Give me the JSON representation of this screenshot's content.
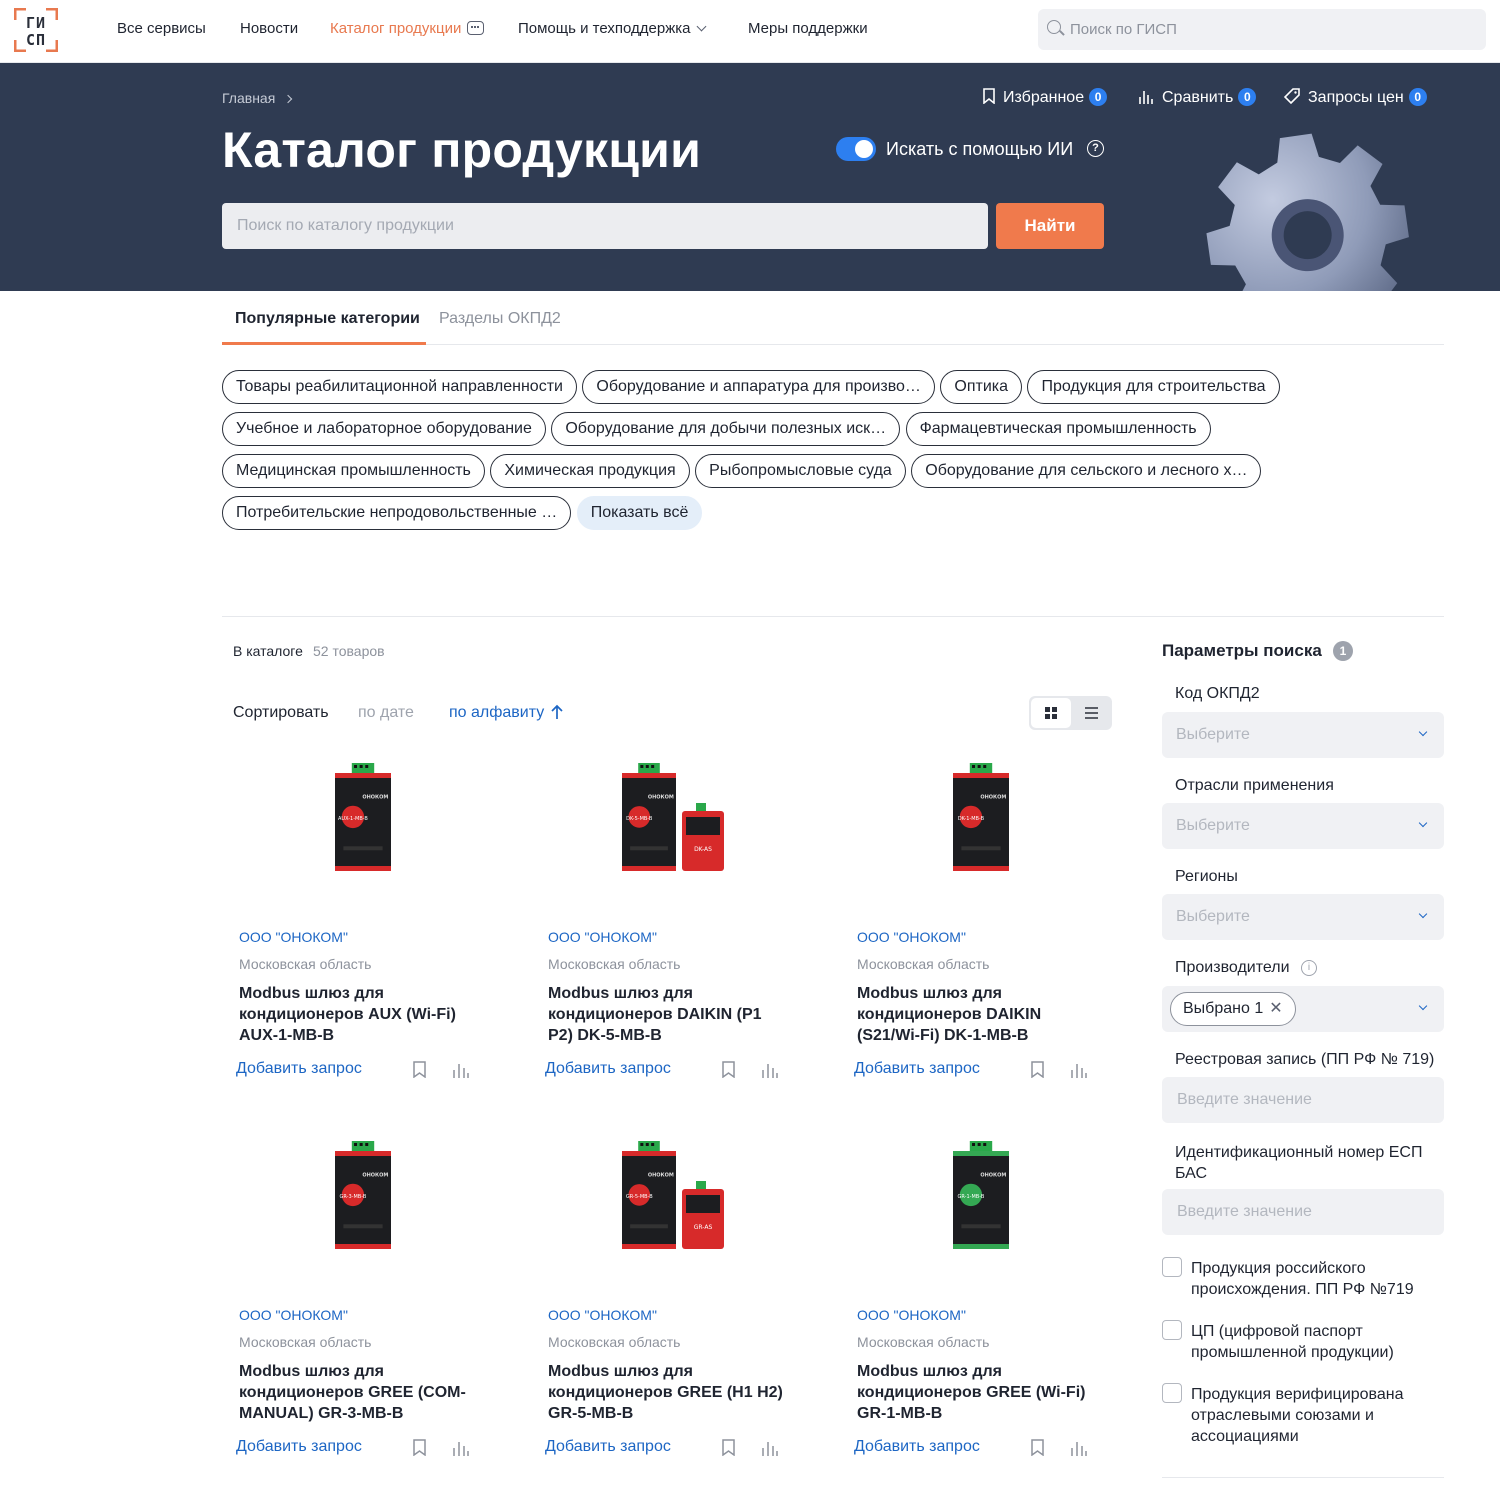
{
  "topnav": {
    "logo_text": "ГИСП",
    "items": [
      {
        "label": "Все сервисы"
      },
      {
        "label": "Новости"
      },
      {
        "label": "Каталог продукции"
      },
      {
        "label": "Помощь и техподдержка"
      },
      {
        "label": "Меры поддержки"
      }
    ],
    "search_placeholder": "Поиск по ГИСП"
  },
  "hero": {
    "breadcrumb": "Главная",
    "title": "Каталог продукции",
    "ai_label": "Искать с помощью ИИ",
    "ai_enabled": true,
    "search_placeholder": "Поиск по каталогу продукции",
    "find_label": "Найти",
    "links": [
      {
        "label": "Избранное",
        "count": "0"
      },
      {
        "label": "Сравнить",
        "count": "0"
      },
      {
        "label": "Запросы цен",
        "count": "0"
      }
    ]
  },
  "tabs": [
    {
      "label": "Популярные категории"
    },
    {
      "label": "Разделы ОКПД2"
    }
  ],
  "categories": [
    [
      "Товары реабилитационной направленности",
      "Оборудование и аппаратура для произво…",
      "Оптика",
      "Продукция для строительства"
    ],
    [
      "Учебное и лабораторное оборудование",
      "Оборудование для добычи полезных иск…",
      "Фармацевтическая промышленность"
    ],
    [
      "Медицинская промышленность",
      "Химическая продукция",
      "Рыбопромысловые суда",
      "Оборудование для сельского и лесного х…"
    ],
    [
      "Потребительские непродовольственные …"
    ]
  ],
  "show_all_label": "Показать всё",
  "listing": {
    "count_label": "В каталоге",
    "count_value": "52 товаров",
    "sort_label": "Сортировать",
    "sort_by_date": "по дате",
    "sort_by_alpha": "по алфавиту"
  },
  "products": [
    {
      "company": "ООО \"ОНОКОМ\"",
      "region": "Московская область",
      "title": "Modbus шлюз для кондиционеров AUX (Wi-Fi) AUX-1-MB-B",
      "add_label": "Добавить запрос",
      "image": {
        "variant": "single",
        "color": "#d72a2a",
        "label": "AUX-1-MB-B"
      }
    },
    {
      "company": "ООО \"ОНОКОМ\"",
      "region": "Московская область",
      "title": "Modbus шлюз для кондиционеров DAIKIN (P1 P2) DK-5-MB-B",
      "add_label": "Добавить запрос",
      "image": {
        "variant": "double",
        "color": "#d72a2a",
        "label": "DK-5-MB-B",
        "label2": "DK-AS"
      }
    },
    {
      "company": "ООО \"ОНОКОМ\"",
      "region": "Московская область",
      "title": "Modbus шлюз для кондиционеров DAIKIN (S21/Wi-Fi) DK-1-MB-B",
      "add_label": "Добавить запрос",
      "image": {
        "variant": "single",
        "color": "#d72a2a",
        "label": "DK-1-MB-B"
      }
    },
    {
      "company": "ООО \"ОНОКОМ\"",
      "region": "Московская область",
      "title": "Modbus шлюз для кондиционеров GREE (COM-MANUAL) GR-3-MB-B",
      "add_label": "Добавить запрос",
      "image": {
        "variant": "single",
        "color": "#d72a2a",
        "label": "GR-3-MB-B"
      }
    },
    {
      "company": "ООО \"ОНОКОМ\"",
      "region": "Московская область",
      "title": "Modbus шлюз для кондиционеров GREE (H1 H2) GR-5-MB-B",
      "add_label": "Добавить запрос",
      "image": {
        "variant": "double",
        "color": "#d72a2a",
        "label": "GR-5-MB-B",
        "label2": "GR-AS"
      }
    },
    {
      "company": "ООО \"ОНОКОМ\"",
      "region": "Московская область",
      "title": "Modbus шлюз для кондиционеров GREE (Wi-Fi) GR-1-MB-B",
      "add_label": "Добавить запрос",
      "image": {
        "variant": "single",
        "color": "#34a853",
        "label": "GR-1-MB-B"
      }
    }
  ],
  "filters": {
    "title": "Параметры поиска",
    "count": "1",
    "okpd_label": "Код ОКПД2",
    "industries_label": "Отрасли применения",
    "regions_label": "Регионы",
    "manufacturers_label": "Производители",
    "select_placeholder": "Выберите",
    "selected_chip": "Выбрано 1",
    "registry_label": "Реестровая запись (ПП РФ № 719)",
    "esp_label": "Идентификационный номер ЕСП БАС",
    "input_placeholder": "Введите значение",
    "checkboxes": [
      {
        "label": "Продукция российского происхождения. ПП РФ №719",
        "checked": false
      },
      {
        "label": "ЦП (цифровой паспорт промышленной продукции)",
        "checked": false
      },
      {
        "label": "Продукция верифицирована отраслевыми союзами и ассоциациями",
        "checked": false
      }
    ]
  },
  "colors": {
    "accent": "#f07a4c",
    "link": "#1d66c4",
    "hero_bg": "#2f3b52",
    "toggle": "#2d7ff0"
  }
}
